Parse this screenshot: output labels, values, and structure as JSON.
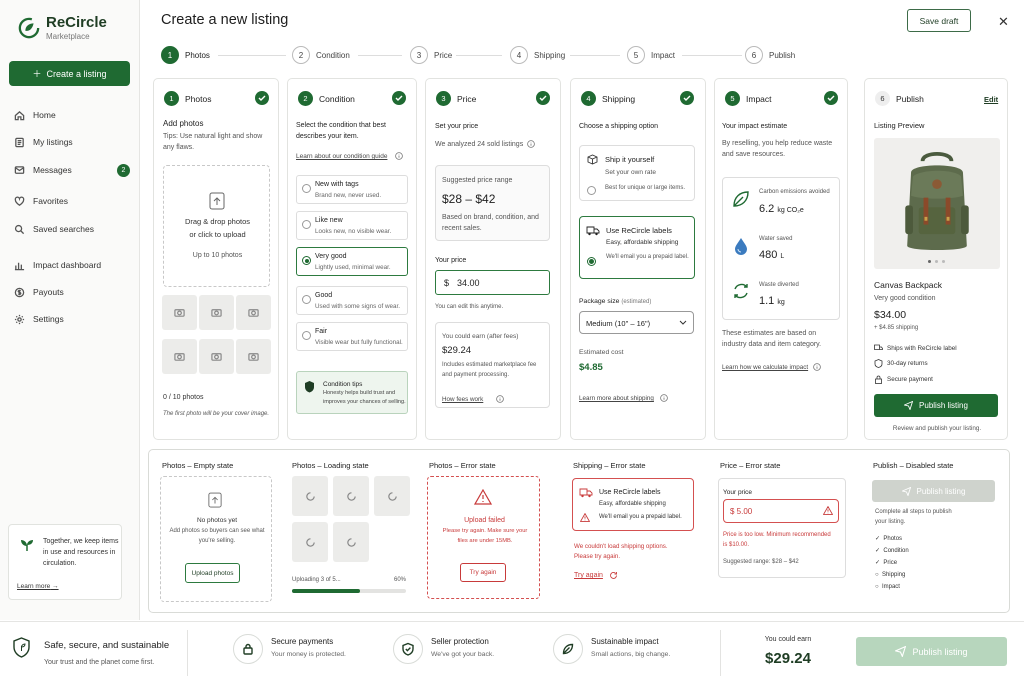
{
  "brand": {
    "name": "ReCircle",
    "sub": "Marketplace"
  },
  "sidebar": {
    "create": "Create a listing",
    "items": [
      {
        "label": "Home",
        "icon": "home-icon"
      },
      {
        "label": "My listings",
        "icon": "tag-icon"
      },
      {
        "label": "Messages",
        "icon": "chat-icon",
        "badge": "2"
      },
      {
        "label": "Favorites",
        "icon": "heart-icon"
      },
      {
        "label": "Saved searches",
        "icon": "search-icon"
      },
      {
        "label": "Impact dashboard",
        "icon": "bar-chart-icon"
      },
      {
        "label": "Payouts",
        "icon": "dollar-icon"
      },
      {
        "label": "Settings",
        "icon": "gear-icon"
      }
    ],
    "note": "Together, we keep items in use and resources in circulation.",
    "note_link": "Learn more"
  },
  "header": {
    "title": "Create a new listing",
    "save": "Save draft",
    "close": "✕"
  },
  "steps": [
    {
      "n": "1",
      "label": "Photos"
    },
    {
      "n": "2",
      "label": "Condition"
    },
    {
      "n": "3",
      "label": "Price"
    },
    {
      "n": "4",
      "label": "Shipping"
    },
    {
      "n": "5",
      "label": "Impact"
    },
    {
      "n": "6",
      "label": "Publish"
    }
  ],
  "photos": {
    "title": "Photos",
    "add": "Add photos",
    "tip": "Tips: Use natural light and show any flaws.",
    "drop1": "Drag & drop photos",
    "drop2": "or click to upload",
    "limit": "Up to 10 photos",
    "count": "0 / 10 photos",
    "cover": "The first photo will be your cover image."
  },
  "condition": {
    "title": "Condition",
    "prompt": "Select the condition that best describes your item.",
    "guide": "Learn about our condition guide",
    "options": [
      {
        "name": "New with tags",
        "desc": "Brand new, never used."
      },
      {
        "name": "Like new",
        "desc": "Looks new, no visible wear."
      },
      {
        "name": "Very good",
        "desc": "Lightly used, minimal wear."
      },
      {
        "name": "Good",
        "desc": "Used with some signs of wear."
      },
      {
        "name": "Fair",
        "desc": "Visible wear but fully functional."
      }
    ],
    "tips_title": "Condition tips",
    "tips": "Honesty helps build trust and improves your chances of selling."
  },
  "price": {
    "title": "Price",
    "set": "Set your price",
    "analyzed": "We analyzed 24 sold listings",
    "range_label": "Suggested price range",
    "range": "$28 – $42",
    "range_note": "Based on brand, condition, and recent sales.",
    "your": "Your price",
    "currency": "$",
    "value": "34.00",
    "edit_note": "You can edit this anytime.",
    "earn_label": "You could earn (after fees)",
    "earn": "$29.24",
    "earn_note": "Includes estimated marketplace fee and payment processing.",
    "fees": "How fees work"
  },
  "shipping": {
    "title": "Shipping",
    "prompt": "Choose a shipping option",
    "self": "Ship it yourself",
    "self_rate": "Set your own rate",
    "self_note": "Best for unique or large items.",
    "label": "Use ReCircle labels",
    "label_sub": "Easy, affordable shipping",
    "label_note": "We'll email you a prepaid label.",
    "pkg": "Package size",
    "pkg_est": "(estimated)",
    "pkg_val": "Medium (10\" – 16\")",
    "cost_label": "Estimated cost",
    "cost": "$4.85",
    "more": "Learn more about shipping"
  },
  "impact": {
    "title": "Impact",
    "estimate": "Your impact estimate",
    "desc": "By reselling, you help reduce waste and save resources.",
    "items": [
      {
        "label": "Carbon emissions avoided",
        "value": "6.2",
        "unit": "kg CO₂e"
      },
      {
        "label": "Water saved",
        "value": "480",
        "unit": "L"
      },
      {
        "label": "Waste diverted",
        "value": "1.1",
        "unit": "kg"
      }
    ],
    "note": "These estimates are based on industry data and item category.",
    "calc": "Learn how we calculate impact"
  },
  "publish": {
    "title": "Publish",
    "edit": "Edit",
    "preview": "Listing Preview",
    "item": "Canvas Backpack",
    "cond": "Very good condition",
    "price": "$34.00",
    "ship": "+ $4.85 shipping",
    "perks": [
      "Ships with ReCircle label",
      "30-day returns",
      "Secure payment"
    ],
    "btn": "Publish listing",
    "review": "Review and publish your listing."
  },
  "states": {
    "empty": {
      "h": "Photos – Empty state",
      "t1": "No photos yet",
      "t2": "Add photos so buyers can see what you're selling.",
      "btn": "Upload photos"
    },
    "loading": {
      "h": "Photos – Loading state",
      "t": "Uploading 3 of 5...",
      "pct": "60%",
      "progress": 0.6
    },
    "perr": {
      "h": "Photos – Error state",
      "t1": "Upload failed",
      "t2": "Please try again. Make sure your files are under 15MB.",
      "btn": "Try again"
    },
    "serr": {
      "h": "Shipping – Error state",
      "t1": "Use ReCircle labels",
      "t2": "Easy, affordable shipping",
      "t3": "We'll email you a prepaid label.",
      "e1": "We couldn't load shipping options.",
      "e2": "Please try again.",
      "retry": "Try again"
    },
    "prerr": {
      "h": "Price – Error state",
      "lbl": "Your price",
      "val": "$  5.00",
      "e": "Price is too low. Minimum recommended is $10.00.",
      "sug": "Suggested range: $28 – $42"
    },
    "pdis": {
      "h": "Publish – Disabled state",
      "btn": "Publish listing",
      "t": "Complete all steps to publish your listing.",
      "list": [
        {
          "l": "Photos",
          "d": true
        },
        {
          "l": "Condition",
          "d": true
        },
        {
          "l": "Price",
          "d": true
        },
        {
          "l": "Shipping",
          "d": false
        },
        {
          "l": "Impact",
          "d": false
        }
      ]
    }
  },
  "footer": {
    "safe": "Safe, secure, and sustainable",
    "safe_sub": "Your trust and the planet come first.",
    "items": [
      {
        "a": "Secure payments",
        "b": "Your money is protected."
      },
      {
        "a": "Seller protection",
        "b": "We've got your back."
      },
      {
        "a": "Sustainable impact",
        "b": "Small actions, big change."
      }
    ],
    "earn_label": "You could earn",
    "earn": "$29.24",
    "btn": "Publish listing"
  }
}
